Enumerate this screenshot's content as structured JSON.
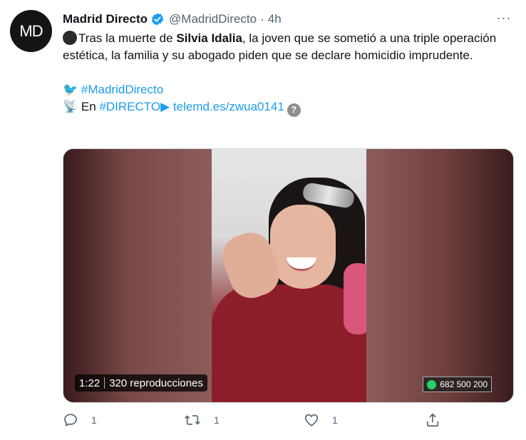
{
  "account": {
    "avatar_initials": "MD",
    "name": "Madrid Directo",
    "handle": "@MadridDirecto",
    "dot": "·",
    "time": "4h"
  },
  "more_label": "···",
  "tweet": {
    "line1_prefix": "Tras la muerte de ",
    "line1_bold": "Silvia Idalia",
    "line1_suffix": ", la joven que se sometió a una triple operación estética, la familia y su abogado piden que se declare homicidio imprudente.",
    "hashtag_line_emoji": "🐦",
    "hashtag": "#MadridDirecto",
    "live_emoji": "📡",
    "live_prefix": "En ",
    "live_hashtag": "#DIRECTO",
    "live_play": "▶",
    "link": "telemd.es/zwua0141",
    "help_glyph": "?"
  },
  "media": {
    "duration": "1:22",
    "views": "320 reproducciones",
    "whatsapp": "682 500 200"
  },
  "actions": {
    "reply_count": "1",
    "retweet_count": "1",
    "like_count": "1"
  },
  "colors": {
    "link": "#1d9bf0",
    "secondary": "#536471",
    "verified": "#1d9bf0"
  }
}
